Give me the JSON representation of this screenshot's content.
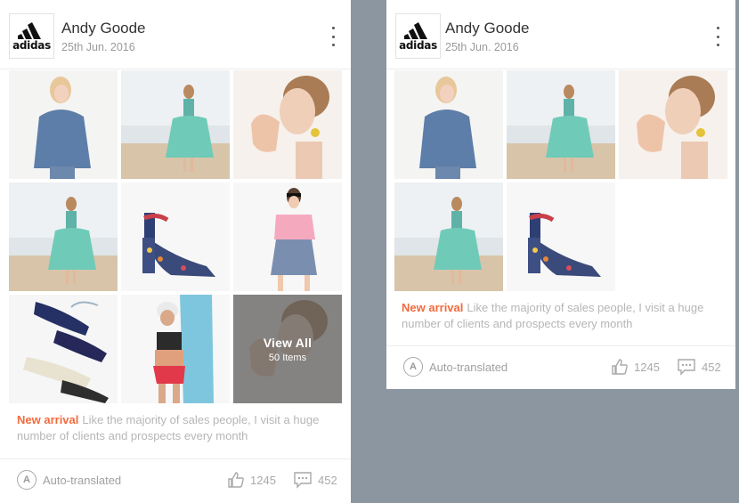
{
  "post": {
    "author": "Andy Goode",
    "date": "25th Jun. 2016",
    "logo_text": "adidas",
    "tag": "New arrival",
    "description": "Like the majority of sales people, I visit a huge number of clients and prospects every month",
    "auto_translated_label": "Auto-translated",
    "auto_icon_letter": "A",
    "likes": "1245",
    "comments": "452"
  },
  "overlay": {
    "view_all": "View All",
    "items_count": "50 Items"
  },
  "colors": {
    "background": "#8b96a1",
    "card": "#ffffff",
    "accent": "#f26a3d",
    "muted_text": "#b6b6b6"
  },
  "icons": [
    "adidas-logo-icon",
    "kebab-menu-icon",
    "auto-translate-icon",
    "thumbs-up-icon",
    "comment-icon"
  ]
}
